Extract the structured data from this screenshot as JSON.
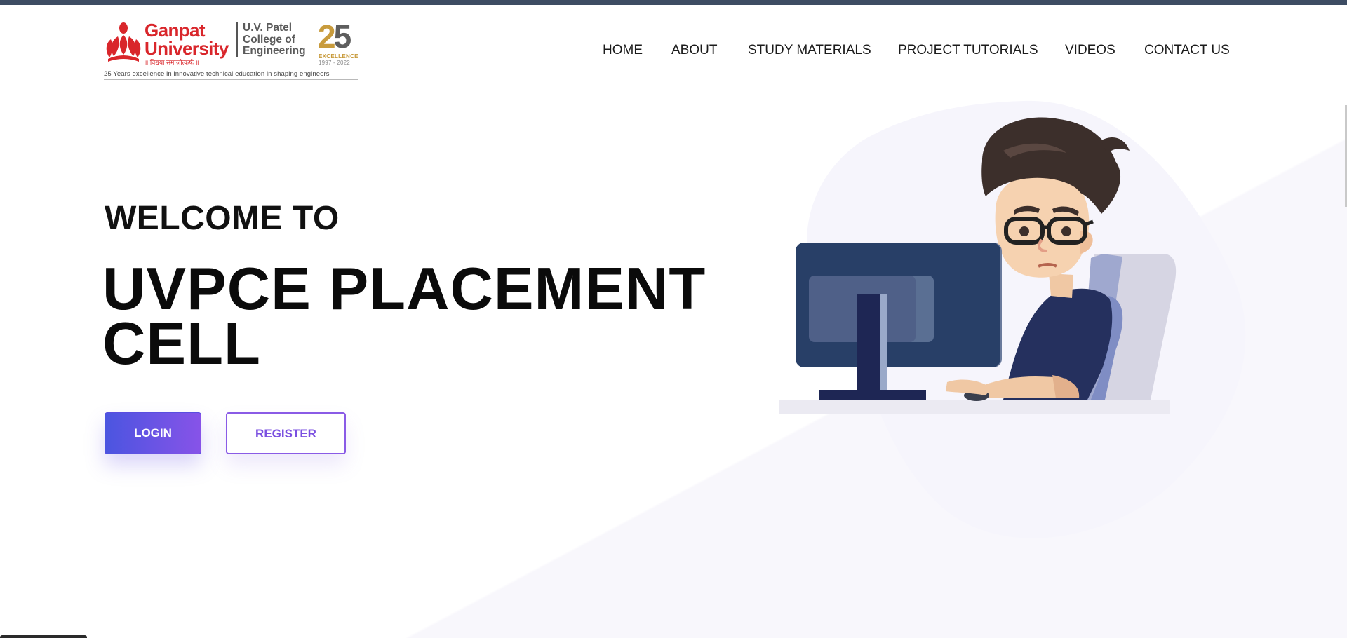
{
  "header": {
    "logo": {
      "university_line1": "Ganpat",
      "university_line2": "University",
      "motto": "॥ विद्यया समाजोत्कर्षः ॥",
      "college_line1": "U.V. Patel",
      "college_line2": "College of",
      "college_line3": "Engineering",
      "badge_digit_1": "2",
      "badge_digit_2": "5",
      "badge_word": "EXCELLENCE",
      "badge_years": "1997 - 2022",
      "tagline": "25 Years excellence in innovative technical education in shaping engineers"
    },
    "nav": [
      {
        "label": "HOME"
      },
      {
        "label": "ABOUT"
      },
      {
        "label": "STUDY MATERIALS"
      },
      {
        "label": "PROJECT TUTORIALS"
      },
      {
        "label": "VIDEOS"
      },
      {
        "label": "CONTACT US"
      }
    ]
  },
  "hero": {
    "welcome": "WELCOME TO",
    "title": "UVPCE PLACEMENT CELL",
    "login_label": "LOGIN",
    "register_label": "REGISTER"
  },
  "colors": {
    "brand_red": "#d9262b",
    "accent_purple": "#7a4fe0",
    "login_gradient_start": "#4b55e0",
    "login_gradient_end": "#8753e8",
    "top_strip": "#3d4c63"
  }
}
